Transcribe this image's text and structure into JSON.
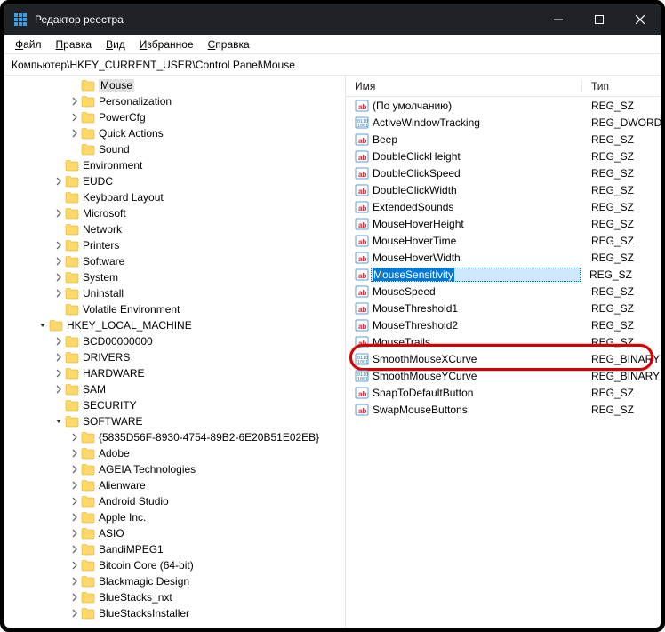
{
  "title": "Редактор реестра",
  "menu": [
    "Файл",
    "Правка",
    "Вид",
    "Избранное",
    "Справка"
  ],
  "address": "Компьютер\\HKEY_CURRENT_USER\\Control Panel\\Mouse",
  "treeTop": [
    {
      "indent": 4,
      "tw": "",
      "label": "Mouse",
      "sel": true
    },
    {
      "indent": 4,
      "tw": ">",
      "label": "Personalization"
    },
    {
      "indent": 4,
      "tw": ">",
      "label": "PowerCfg"
    },
    {
      "indent": 4,
      "tw": ">",
      "label": "Quick Actions"
    },
    {
      "indent": 4,
      "tw": "",
      "label": "Sound"
    },
    {
      "indent": 3,
      "tw": "",
      "label": "Environment"
    },
    {
      "indent": 3,
      "tw": ">",
      "label": "EUDC"
    },
    {
      "indent": 3,
      "tw": "",
      "label": "Keyboard Layout"
    },
    {
      "indent": 3,
      "tw": ">",
      "label": "Microsoft"
    },
    {
      "indent": 3,
      "tw": "",
      "label": "Network"
    },
    {
      "indent": 3,
      "tw": ">",
      "label": "Printers"
    },
    {
      "indent": 3,
      "tw": ">",
      "label": "Software"
    },
    {
      "indent": 3,
      "tw": ">",
      "label": "System"
    },
    {
      "indent": 3,
      "tw": ">",
      "label": "Uninstall"
    },
    {
      "indent": 3,
      "tw": "",
      "label": "Volatile Environment"
    },
    {
      "indent": 2,
      "tw": "v",
      "label": "HKEY_LOCAL_MACHINE"
    },
    {
      "indent": 3,
      "tw": ">",
      "label": "BCD00000000"
    },
    {
      "indent": 3,
      "tw": ">",
      "label": "DRIVERS"
    },
    {
      "indent": 3,
      "tw": ">",
      "label": "HARDWARE"
    },
    {
      "indent": 3,
      "tw": ">",
      "label": "SAM"
    },
    {
      "indent": 3,
      "tw": "",
      "label": "SECURITY"
    },
    {
      "indent": 3,
      "tw": "v",
      "label": "SOFTWARE"
    },
    {
      "indent": 4,
      "tw": ">",
      "label": "{5835D56F-8930-4754-89B2-6E20B51E02EB}"
    },
    {
      "indent": 4,
      "tw": ">",
      "label": "Adobe"
    },
    {
      "indent": 4,
      "tw": ">",
      "label": "AGEIA Technologies"
    },
    {
      "indent": 4,
      "tw": ">",
      "label": "Alienware"
    },
    {
      "indent": 4,
      "tw": ">",
      "label": "Android Studio"
    },
    {
      "indent": 4,
      "tw": ">",
      "label": "Apple Inc."
    },
    {
      "indent": 4,
      "tw": ">",
      "label": "ASIO"
    },
    {
      "indent": 4,
      "tw": ">",
      "label": "BandiMPEG1"
    },
    {
      "indent": 4,
      "tw": ">",
      "label": "Bitcoin Core (64-bit)"
    },
    {
      "indent": 4,
      "tw": ">",
      "label": "Blackmagic Design"
    },
    {
      "indent": 4,
      "tw": ">",
      "label": "BlueStacks_nxt"
    },
    {
      "indent": 4,
      "tw": ">",
      "label": "BlueStacksInstaller"
    }
  ],
  "listHeader": {
    "name": "Имя",
    "type": "Тип"
  },
  "values": [
    {
      "icon": "str",
      "name": "(По умолчанию)",
      "type": "REG_SZ"
    },
    {
      "icon": "bin",
      "name": "ActiveWindowTracking",
      "type": "REG_DWORD"
    },
    {
      "icon": "str",
      "name": "Beep",
      "type": "REG_SZ"
    },
    {
      "icon": "str",
      "name": "DoubleClickHeight",
      "type": "REG_SZ"
    },
    {
      "icon": "str",
      "name": "DoubleClickSpeed",
      "type": "REG_SZ"
    },
    {
      "icon": "str",
      "name": "DoubleClickWidth",
      "type": "REG_SZ"
    },
    {
      "icon": "str",
      "name": "ExtendedSounds",
      "type": "REG_SZ"
    },
    {
      "icon": "str",
      "name": "MouseHoverHeight",
      "type": "REG_SZ"
    },
    {
      "icon": "str",
      "name": "MouseHoverTime",
      "type": "REG_SZ"
    },
    {
      "icon": "str",
      "name": "MouseHoverWidth",
      "type": "REG_SZ"
    },
    {
      "icon": "str",
      "name": "MouseSensitivity",
      "type": "REG_SZ",
      "sel": true
    },
    {
      "icon": "str",
      "name": "MouseSpeed",
      "type": "REG_SZ"
    },
    {
      "icon": "str",
      "name": "MouseThreshold1",
      "type": "REG_SZ"
    },
    {
      "icon": "str",
      "name": "MouseThreshold2",
      "type": "REG_SZ"
    },
    {
      "icon": "str",
      "name": "MouseTrails",
      "type": "REG_SZ"
    },
    {
      "icon": "bin",
      "name": "SmoothMouseXCurve",
      "type": "REG_BINARY",
      "ring": true
    },
    {
      "icon": "bin",
      "name": "SmoothMouseYCurve",
      "type": "REG_BINARY"
    },
    {
      "icon": "str",
      "name": "SnapToDefaultButton",
      "type": "REG_SZ"
    },
    {
      "icon": "str",
      "name": "SwapMouseButtons",
      "type": "REG_SZ"
    }
  ]
}
